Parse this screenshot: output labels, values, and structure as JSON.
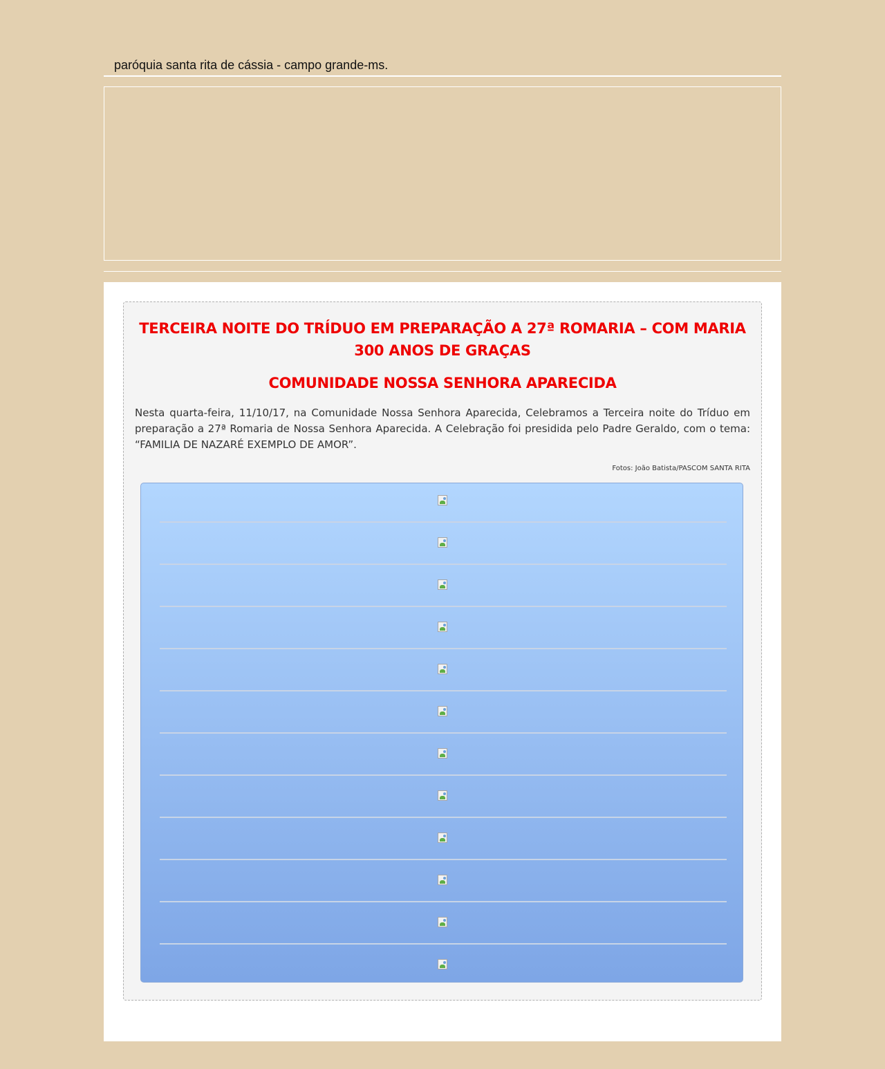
{
  "site": {
    "title": "paróquia santa rita de cássia - campo grande-ms."
  },
  "post": {
    "title": "TERCEIRA NOITE DO TRÍDUO EM PREPARAÇÃO A 27ª ROMARIA – COM MARIA 300 ANOS DE GRAÇAS",
    "subtitle": "COMUNIDADE NOSSA SENHORA APARECIDA",
    "body": "Nesta quarta-feira, 11/10/17, na Comunidade Nossa Senhora Aparecida, Celebramos a Terceira noite do Tríduo em preparação a 27ª Romaria de Nossa Senhora Aparecida. A Celebração foi presidida pelo Padre Geraldo, com o tema: “FAMILIA DE NAZARÉ EXEMPLO DE AMOR”.",
    "photo_credit": "Fotos: João Batista/PASCOM SANTA RITA"
  },
  "gallery": {
    "image_count": 12,
    "icon": "broken-image-icon"
  },
  "colors": {
    "page_background": "#e3d0b0",
    "title_red": "#ee0000",
    "gallery_top": "#b2d6fe",
    "gallery_bottom": "#7ea6e6"
  }
}
